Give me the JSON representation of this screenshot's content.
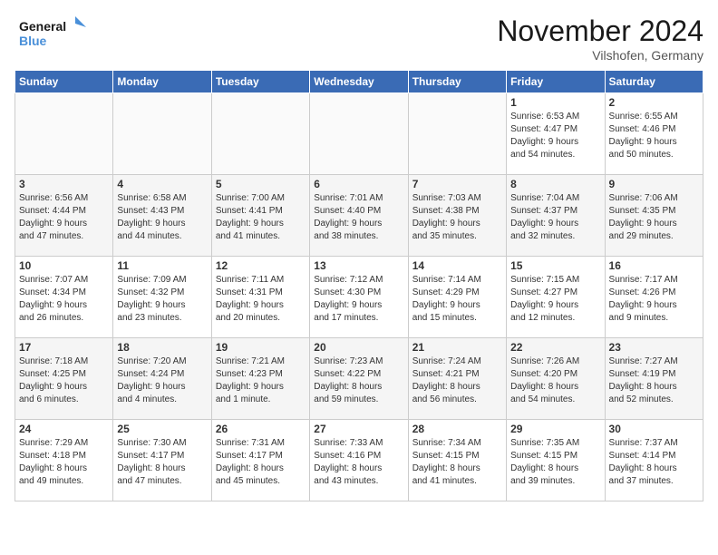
{
  "header": {
    "logo_line1": "General",
    "logo_line2": "Blue",
    "month": "November 2024",
    "location": "Vilshofen, Germany"
  },
  "weekdays": [
    "Sunday",
    "Monday",
    "Tuesday",
    "Wednesday",
    "Thursday",
    "Friday",
    "Saturday"
  ],
  "weeks": [
    [
      {
        "day": "",
        "info": ""
      },
      {
        "day": "",
        "info": ""
      },
      {
        "day": "",
        "info": ""
      },
      {
        "day": "",
        "info": ""
      },
      {
        "day": "",
        "info": ""
      },
      {
        "day": "1",
        "info": "Sunrise: 6:53 AM\nSunset: 4:47 PM\nDaylight: 9 hours\nand 54 minutes."
      },
      {
        "day": "2",
        "info": "Sunrise: 6:55 AM\nSunset: 4:46 PM\nDaylight: 9 hours\nand 50 minutes."
      }
    ],
    [
      {
        "day": "3",
        "info": "Sunrise: 6:56 AM\nSunset: 4:44 PM\nDaylight: 9 hours\nand 47 minutes."
      },
      {
        "day": "4",
        "info": "Sunrise: 6:58 AM\nSunset: 4:43 PM\nDaylight: 9 hours\nand 44 minutes."
      },
      {
        "day": "5",
        "info": "Sunrise: 7:00 AM\nSunset: 4:41 PM\nDaylight: 9 hours\nand 41 minutes."
      },
      {
        "day": "6",
        "info": "Sunrise: 7:01 AM\nSunset: 4:40 PM\nDaylight: 9 hours\nand 38 minutes."
      },
      {
        "day": "7",
        "info": "Sunrise: 7:03 AM\nSunset: 4:38 PM\nDaylight: 9 hours\nand 35 minutes."
      },
      {
        "day": "8",
        "info": "Sunrise: 7:04 AM\nSunset: 4:37 PM\nDaylight: 9 hours\nand 32 minutes."
      },
      {
        "day": "9",
        "info": "Sunrise: 7:06 AM\nSunset: 4:35 PM\nDaylight: 9 hours\nand 29 minutes."
      }
    ],
    [
      {
        "day": "10",
        "info": "Sunrise: 7:07 AM\nSunset: 4:34 PM\nDaylight: 9 hours\nand 26 minutes."
      },
      {
        "day": "11",
        "info": "Sunrise: 7:09 AM\nSunset: 4:32 PM\nDaylight: 9 hours\nand 23 minutes."
      },
      {
        "day": "12",
        "info": "Sunrise: 7:11 AM\nSunset: 4:31 PM\nDaylight: 9 hours\nand 20 minutes."
      },
      {
        "day": "13",
        "info": "Sunrise: 7:12 AM\nSunset: 4:30 PM\nDaylight: 9 hours\nand 17 minutes."
      },
      {
        "day": "14",
        "info": "Sunrise: 7:14 AM\nSunset: 4:29 PM\nDaylight: 9 hours\nand 15 minutes."
      },
      {
        "day": "15",
        "info": "Sunrise: 7:15 AM\nSunset: 4:27 PM\nDaylight: 9 hours\nand 12 minutes."
      },
      {
        "day": "16",
        "info": "Sunrise: 7:17 AM\nSunset: 4:26 PM\nDaylight: 9 hours\nand 9 minutes."
      }
    ],
    [
      {
        "day": "17",
        "info": "Sunrise: 7:18 AM\nSunset: 4:25 PM\nDaylight: 9 hours\nand 6 minutes."
      },
      {
        "day": "18",
        "info": "Sunrise: 7:20 AM\nSunset: 4:24 PM\nDaylight: 9 hours\nand 4 minutes."
      },
      {
        "day": "19",
        "info": "Sunrise: 7:21 AM\nSunset: 4:23 PM\nDaylight: 9 hours\nand 1 minute."
      },
      {
        "day": "20",
        "info": "Sunrise: 7:23 AM\nSunset: 4:22 PM\nDaylight: 8 hours\nand 59 minutes."
      },
      {
        "day": "21",
        "info": "Sunrise: 7:24 AM\nSunset: 4:21 PM\nDaylight: 8 hours\nand 56 minutes."
      },
      {
        "day": "22",
        "info": "Sunrise: 7:26 AM\nSunset: 4:20 PM\nDaylight: 8 hours\nand 54 minutes."
      },
      {
        "day": "23",
        "info": "Sunrise: 7:27 AM\nSunset: 4:19 PM\nDaylight: 8 hours\nand 52 minutes."
      }
    ],
    [
      {
        "day": "24",
        "info": "Sunrise: 7:29 AM\nSunset: 4:18 PM\nDaylight: 8 hours\nand 49 minutes."
      },
      {
        "day": "25",
        "info": "Sunrise: 7:30 AM\nSunset: 4:17 PM\nDaylight: 8 hours\nand 47 minutes."
      },
      {
        "day": "26",
        "info": "Sunrise: 7:31 AM\nSunset: 4:17 PM\nDaylight: 8 hours\nand 45 minutes."
      },
      {
        "day": "27",
        "info": "Sunrise: 7:33 AM\nSunset: 4:16 PM\nDaylight: 8 hours\nand 43 minutes."
      },
      {
        "day": "28",
        "info": "Sunrise: 7:34 AM\nSunset: 4:15 PM\nDaylight: 8 hours\nand 41 minutes."
      },
      {
        "day": "29",
        "info": "Sunrise: 7:35 AM\nSunset: 4:15 PM\nDaylight: 8 hours\nand 39 minutes."
      },
      {
        "day": "30",
        "info": "Sunrise: 7:37 AM\nSunset: 4:14 PM\nDaylight: 8 hours\nand 37 minutes."
      }
    ]
  ]
}
